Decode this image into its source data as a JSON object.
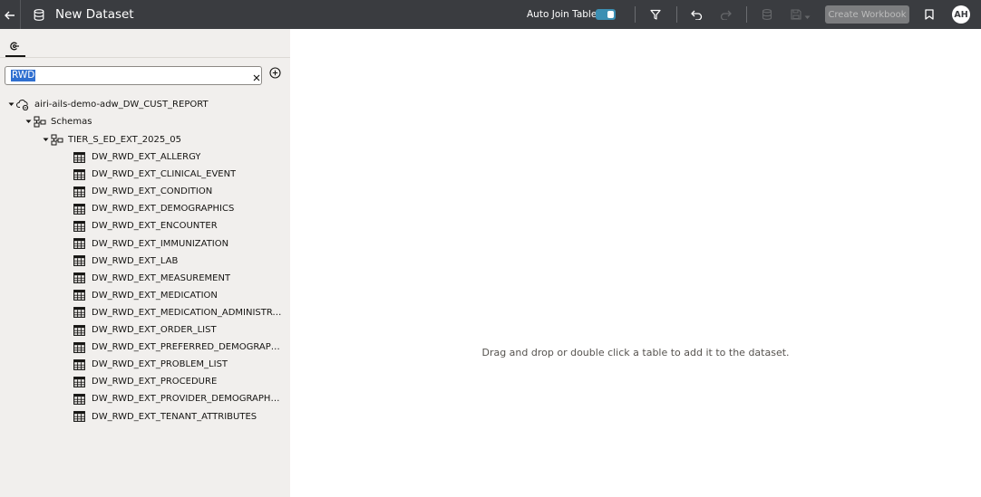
{
  "header": {
    "title": "New Dataset",
    "auto_join_label": "Auto Join Tables",
    "auto_join_enabled": true,
    "create_workbook_label": "Create Workbook",
    "avatar_initials": "AH",
    "icons": [
      "back-arrow-icon",
      "database-icon",
      "filter-icon",
      "undo-icon",
      "redo-icon",
      "data-stack-icon",
      "save-icon",
      "bookmark-icon"
    ],
    "colors": {
      "bar": "#3a3c40",
      "toggle_on": "#3c8fb3",
      "button_disabled": "#7c7d7f"
    }
  },
  "sidebar": {
    "tab_icon": "connections-icon",
    "search": {
      "value": "RWD",
      "placeholder": ""
    },
    "tree": {
      "connection": "airi-ails-demo-adw_DW_CUST_REPORT",
      "schemas_label": "Schemas",
      "schema": "TIER_S_ED_EXT_2025_05",
      "tables": [
        "DW_RWD_EXT_ALLERGY",
        "DW_RWD_EXT_CLINICAL_EVENT",
        "DW_RWD_EXT_CONDITION",
        "DW_RWD_EXT_DEMOGRAPHICS",
        "DW_RWD_EXT_ENCOUNTER",
        "DW_RWD_EXT_IMMUNIZATION",
        "DW_RWD_EXT_LAB",
        "DW_RWD_EXT_MEASUREMENT",
        "DW_RWD_EXT_MEDICATION",
        "DW_RWD_EXT_MEDICATION_ADMINISTRAT...",
        "DW_RWD_EXT_ORDER_LIST",
        "DW_RWD_EXT_PREFERRED_DEMOGRAPHICS",
        "DW_RWD_EXT_PROBLEM_LIST",
        "DW_RWD_EXT_PROCEDURE",
        "DW_RWD_EXT_PROVIDER_DEMOGRAPHICS",
        "DW_RWD_EXT_TENANT_ATTRIBUTES"
      ]
    }
  },
  "canvas": {
    "hint": "Drag and drop or double click a table to add it to the dataset."
  }
}
